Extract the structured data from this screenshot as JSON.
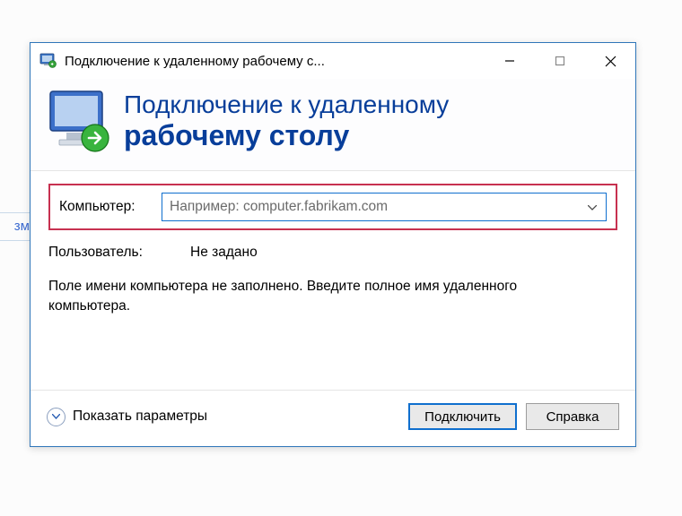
{
  "bg_fragment": "зм",
  "titlebar": {
    "title": "Подключение к удаленному рабочему с..."
  },
  "header": {
    "line1": "Подключение к удаленному",
    "line2": "рабочему столу"
  },
  "body": {
    "computer_label": "Компьютер:",
    "computer_placeholder": "Например: computer.fabrikam.com",
    "user_label": "Пользователь:",
    "user_value": "Не задано",
    "hint": "Поле имени компьютера не заполнено. Введите полное имя удаленного компьютера."
  },
  "footer": {
    "expand_label": "Показать параметры",
    "connect_label": "Подключить",
    "help_label": "Справка"
  }
}
